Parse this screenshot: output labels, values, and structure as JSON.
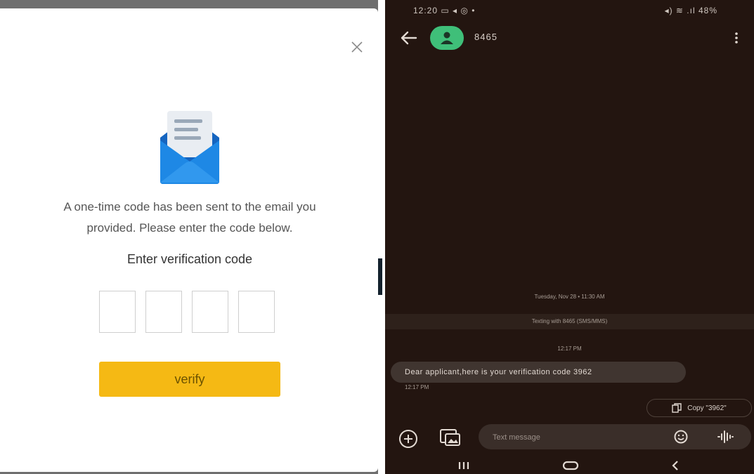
{
  "modal": {
    "close_symbol": "×",
    "message_line1": "A one-time code has been sent to the email you",
    "message_line2": "provided. Please enter the code below.",
    "code_label": "Enter verification code",
    "code_digits": [
      "",
      "",
      "",
      ""
    ],
    "verify_label": "verify",
    "accent_color": "#f5b914",
    "envelope_color": "#1e88e5"
  },
  "phone": {
    "status": {
      "time": "12:20",
      "left_icons": "▭ ◂ ◎ •",
      "right_text": "◂) ≋ .ıl 48%"
    },
    "contact": {
      "name": "8465"
    },
    "date_separator": "Tuesday, Nov 28 • 11:30 AM",
    "texting_info": "Texting with 8465 (SMS/MMS)",
    "time_separator": "12:17 PM",
    "message": {
      "text": "Dear  applicant,here is your verification code 3962",
      "time": "12:17 PM"
    },
    "copy_chip_label": "Copy \"3962\"",
    "input_placeholder": "Text message",
    "background_color": "#231510",
    "avatar_color": "#3fbf79"
  }
}
